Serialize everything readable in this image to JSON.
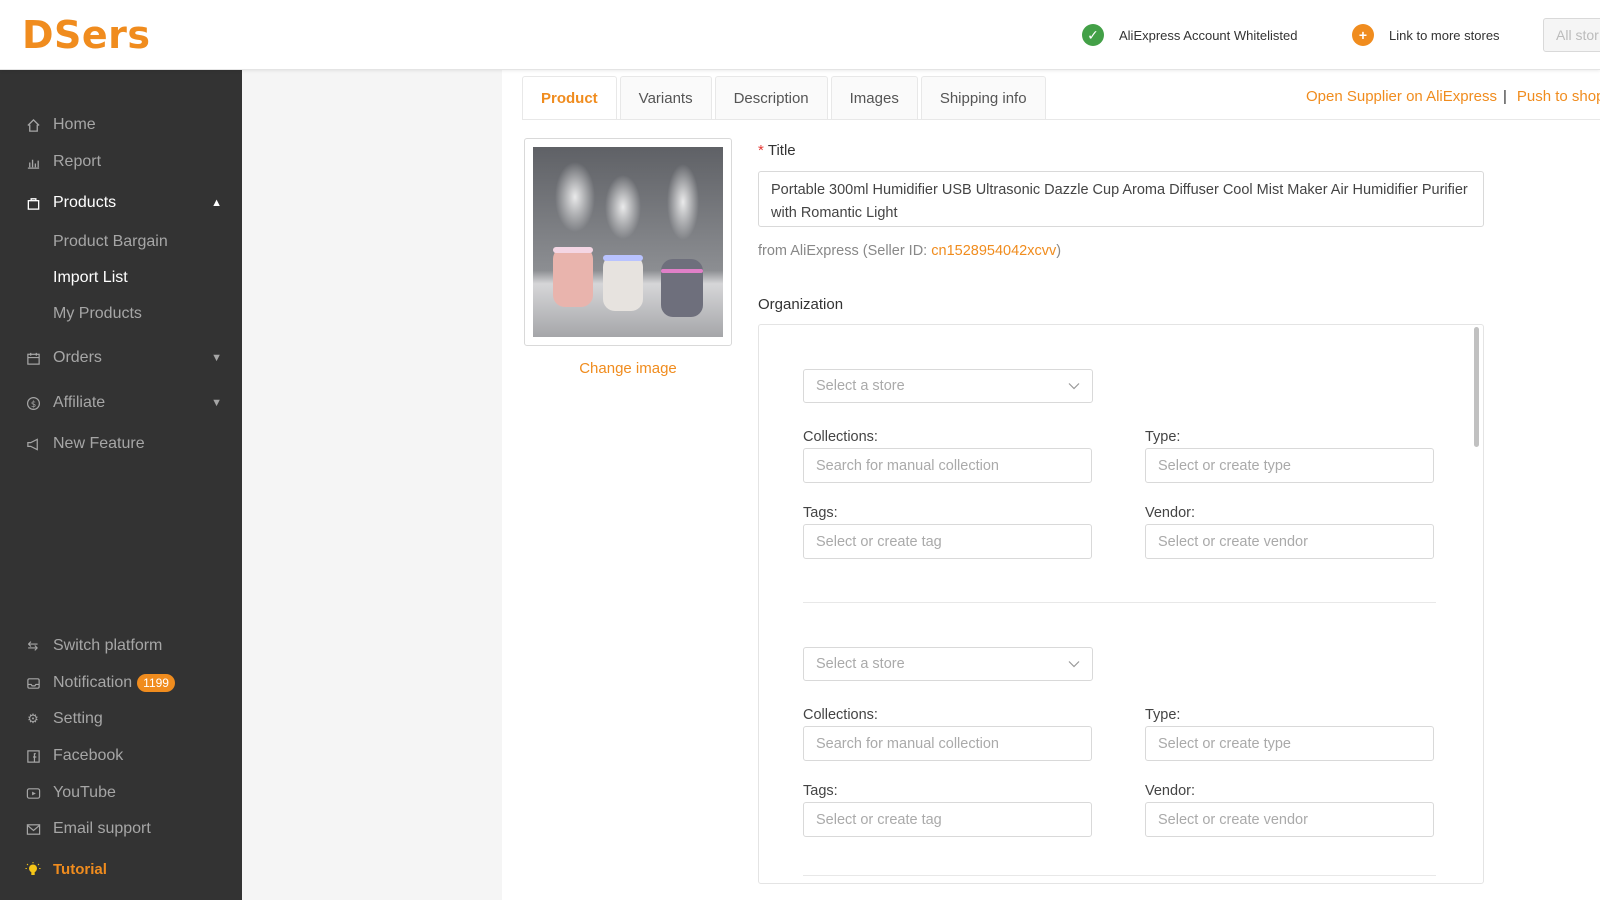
{
  "header": {
    "logo": "DSers",
    "whitelist_text": "AliExpress Account Whitelisted",
    "link_stores_text": "Link to more stores",
    "store_select": "All stor"
  },
  "sidebar": {
    "items": [
      {
        "label": "Home",
        "icon": "home-icon"
      },
      {
        "label": "Report",
        "icon": "bar-chart-icon"
      },
      {
        "label": "Products",
        "icon": "bag-icon"
      },
      {
        "label": "Orders",
        "icon": "calendar-icon"
      },
      {
        "label": "Affiliate",
        "icon": "dollar-icon"
      },
      {
        "label": "New Feature",
        "icon": "megaphone-icon"
      }
    ],
    "product_sub": [
      "Product Bargain",
      "Import List",
      "My Products"
    ],
    "bottom": [
      {
        "label": "Switch platform",
        "icon": "swap-icon"
      },
      {
        "label": "Notification",
        "icon": "inbox-icon",
        "badge": "1199"
      },
      {
        "label": "Setting",
        "icon": "gear-icon"
      },
      {
        "label": "Facebook",
        "icon": "facebook-icon"
      },
      {
        "label": "YouTube",
        "icon": "youtube-icon"
      },
      {
        "label": "Email support",
        "icon": "mail-icon"
      },
      {
        "label": "Tutorial",
        "icon": "lightbulb-icon"
      }
    ]
  },
  "tabs": [
    "Product",
    "Variants",
    "Description",
    "Images",
    "Shipping info"
  ],
  "top_links": {
    "open_supplier": "Open Supplier on AliExpress",
    "separator": "|",
    "push": "Push to shop"
  },
  "product": {
    "change_image": "Change image",
    "title_label": "Title",
    "title_value": "Portable 300ml Humidifier USB Ultrasonic Dazzle Cup Aroma Diffuser Cool Mist Maker Air Humidifier Purifier with Romantic Light",
    "from_prefix": "from AliExpress (Seller ID: ",
    "seller_id": "cn1528954042xcvv",
    "from_suffix": ")",
    "organization_label": "Organization"
  },
  "organization": {
    "store_placeholder": "Select a store",
    "collections_label": "Collections:",
    "collections_placeholder": "Search for manual collection",
    "type_label": "Type:",
    "type_placeholder": "Select or create type",
    "tags_label": "Tags:",
    "tags_placeholder": "Select or create tag",
    "vendor_label": "Vendor:",
    "vendor_placeholder": "Select or create vendor"
  },
  "colors": {
    "accent": "#f08c1e",
    "sidebar_bg": "#333333",
    "success": "#43a047"
  }
}
